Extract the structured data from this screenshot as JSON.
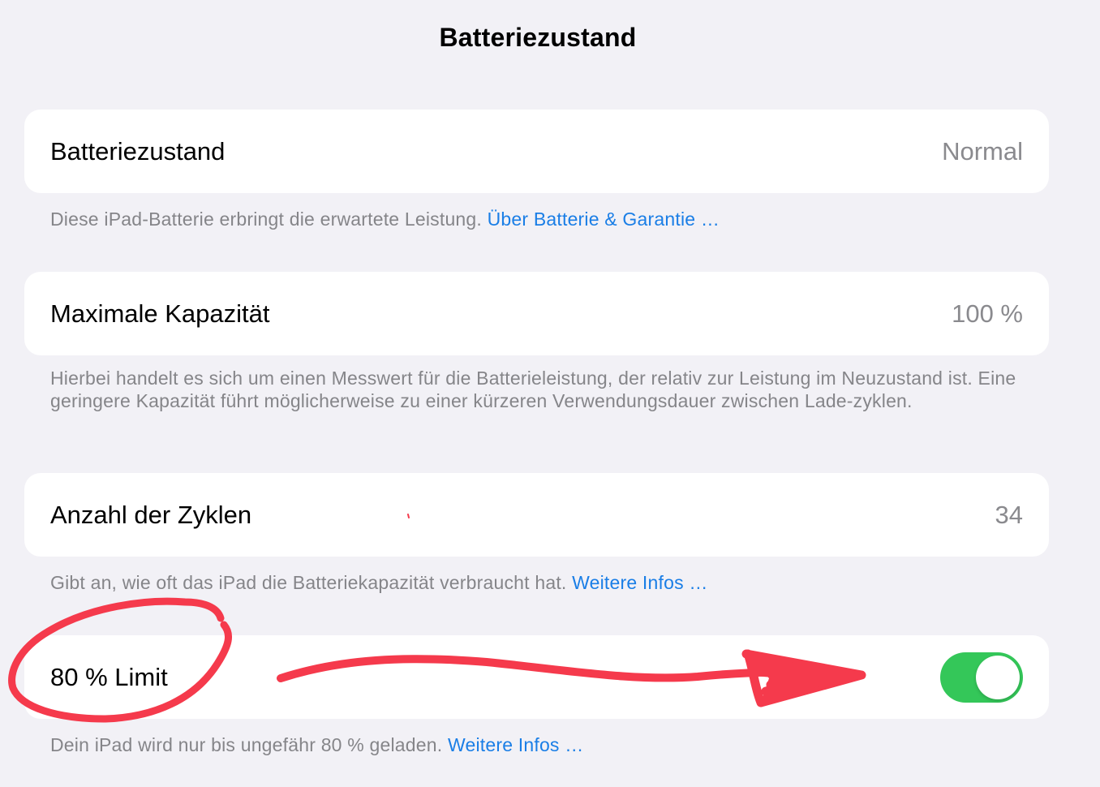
{
  "page": {
    "title": "Batteriezustand"
  },
  "sections": [
    {
      "label": "Batteriezustand",
      "value": "Normal",
      "footer_text": "Diese iPad-Batterie erbringt die erwartete Leistung. ",
      "footer_link": "Über Batterie & Garantie …"
    },
    {
      "label": "Maximale Kapazität",
      "value": "100 %",
      "footer_text": "Hierbei handelt es sich um einen Messwert für die Batterieleistung, der relativ zur Leistung im Neuzustand ist. Eine geringere Kapazität führt möglicherweise zu einer kürzeren Verwendungsdauer zwischen Lade-zyklen."
    },
    {
      "label": "Anzahl der Zyklen",
      "value": "34",
      "footer_text": "Gibt an, wie oft das iPad die Batteriekapazität verbraucht hat. ",
      "footer_link": "Weitere Infos …"
    },
    {
      "label": "80 % Limit",
      "toggle_on": true,
      "footer_text": "Dein iPad wird nur bis ungefähr 80 % geladen. ",
      "footer_link": "Weitere Infos …"
    }
  ],
  "colors": {
    "background": "#f2f1f6",
    "card": "#ffffff",
    "link": "#1a7ee6",
    "toggle_on": "#34c759",
    "annotation": "#f53a4c"
  },
  "annotation": {
    "marker_color": "#f53a4c",
    "shapes": [
      "hand-drawn-circle",
      "hand-drawn-arrow"
    ]
  }
}
